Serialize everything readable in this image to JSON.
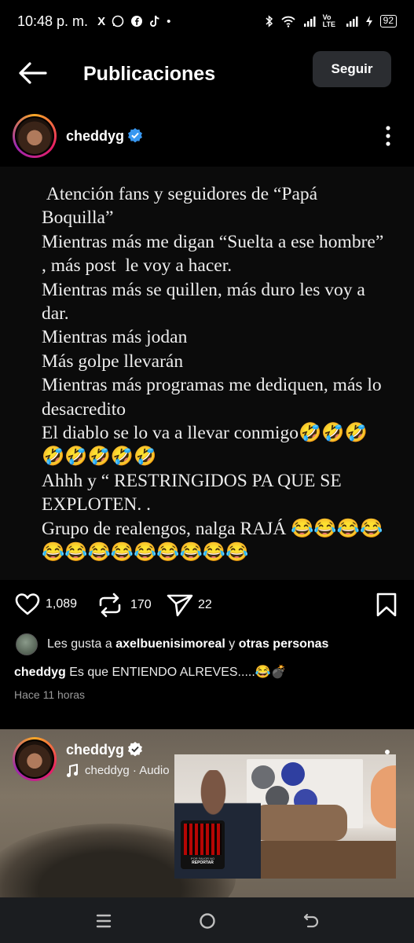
{
  "status_bar": {
    "time": "10:48 p. m.",
    "apps": [
      "X",
      "WhatsApp",
      "Facebook",
      "TikTok",
      "•"
    ],
    "network": "Vo LTE",
    "battery": "92"
  },
  "header": {
    "title": "Publicaciones",
    "follow_label": "Seguir"
  },
  "post": {
    "username": "cheddyg",
    "text": " Atención fans y seguidores de “Papá Boquilla”\nMientras más me digan “Suelta a ese hombre” , más post  le voy a hacer.\nMientras más se quillen, más duro les voy a dar.\nMientras más jodan\nMás golpe llevarán\nMientras más programas me dediquen, más lo desacredito\nEl diablo se lo va a llevar conmigo🤣🤣🤣🤣🤣🤣🤣🤣\nAhhh y “ RESTRINGIDOS PA QUE SE EXPLOTEN. .\nGrupo de realengos, nalga RAJÁ 😂😂😂😂😂😂😂😂😂😂😂😂😂",
    "likes_count": "1,089",
    "reposts_count": "170",
    "shares_count": "22",
    "liked_by_prefix": "Les gusta a",
    "liked_by_user": "axelbuenisimoreal",
    "liked_by_joiner": "y",
    "liked_by_others": "otras personas",
    "caption_user": "cheddyg",
    "caption_text": "Es que ENTIENDO ALREVES.....😂💣",
    "time_ago": "Hace 11 horas"
  },
  "next_post": {
    "username": "cheddyg",
    "audio_label": "cheddyg · Audio",
    "qr_caption": "POR FAVOR NO",
    "qr_report": "REPORTAR"
  },
  "colors": {
    "background": "#000000",
    "verified": "#3897f0",
    "follow_button": "#2b2d31",
    "navbar": "#1b1d20"
  },
  "icons": [
    "back-arrow-icon",
    "verified-icon",
    "more-options-icon",
    "heart-icon",
    "repost-icon",
    "send-icon",
    "bookmark-icon",
    "music-icon",
    "recents-icon",
    "home-icon",
    "back-nav-icon"
  ]
}
